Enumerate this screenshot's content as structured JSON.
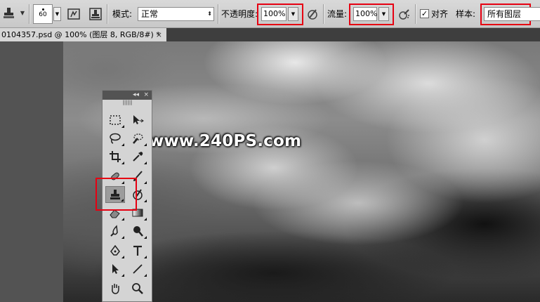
{
  "options_bar": {
    "brush_size": "60",
    "mode_label": "模式:",
    "mode_value": "正常",
    "opacity_label": "不透明度:",
    "opacity_value": "100%",
    "flow_label": "流量:",
    "flow_value": "100%",
    "aligned_label": "对齐",
    "aligned_checked": "✓",
    "sample_label": "样本:",
    "sample_value": "所有图层"
  },
  "document_tab": {
    "title": "0104357.psd @ 100% (图层 8, RGB/8#) *",
    "close": "×"
  },
  "canvas": {
    "watermark": "www.240PS.com"
  },
  "tools_panel": {
    "collapse": "◂◂",
    "close": "×",
    "active_tool": "clone-stamp-tool"
  },
  "colors": {
    "highlight_box": "#e60012",
    "workspace": "#535353",
    "panel": "#d4d4d4"
  }
}
